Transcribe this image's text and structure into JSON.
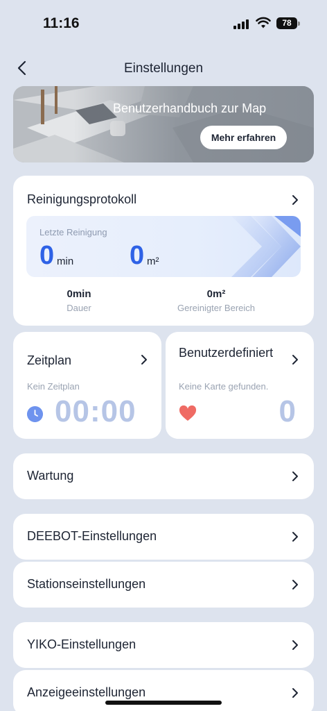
{
  "status": {
    "time": "11:16",
    "battery": "78"
  },
  "header": {
    "title": "Einstellungen"
  },
  "banner": {
    "title": "Benutzerhandbuch zur Map",
    "button": "Mehr erfahren"
  },
  "protocol": {
    "title": "Reinigungsprotokoll",
    "last_label": "Letzte Reinigung",
    "duration_value": "0",
    "duration_unit": "min",
    "area_value": "0",
    "area_unit": "m²",
    "stat_duration_value": "0min",
    "stat_duration_label": "Dauer",
    "stat_area_value": "0m²",
    "stat_area_label": "Gereinigter Bereich"
  },
  "schedule": {
    "title": "Zeitplan",
    "subtitle": "Kein Zeitplan",
    "time": "00:00"
  },
  "custom": {
    "title": "Benutzerdefiniert",
    "subtitle": "Keine Karte gefunden.",
    "count": "0"
  },
  "rows": [
    {
      "label": "Wartung"
    },
    {
      "label": "DEEBOT-Einstellungen"
    },
    {
      "label": "Stationseinstellungen"
    },
    {
      "label": "YIKO-Einstellungen"
    },
    {
      "label": "Anzeigeeinstellungen"
    }
  ],
  "colors": {
    "accent": "#2f62e6",
    "background": "#dde3ee",
    "heart": "#ef6b64",
    "muted_number": "#b6c5e6"
  }
}
